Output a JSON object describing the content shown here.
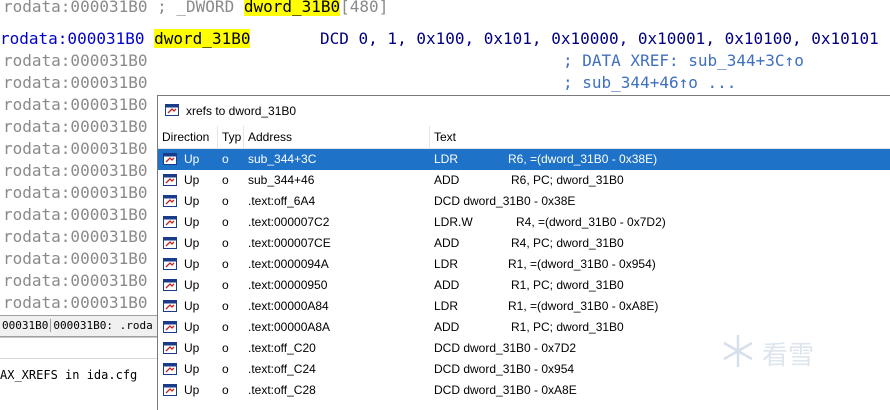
{
  "code_lines": [
    {
      "addr": "rodata:000031B0",
      "rest1": " ; _DWORD ",
      "hl": "dword_31B0",
      "rest2": "[480]"
    },
    {
      "addr": "rodata:000031B0",
      "label": "dword_31B0",
      "instr": "DCD 0, 1, 0x100, 0x101, 0x10000, 0x10001, 0x10100, 0x10101"
    },
    {
      "addr": "rodata:000031B0",
      "comment": "; DATA XREF: sub_344+3C↑o"
    },
    {
      "addr": "rodata:000031B0",
      "comment": "; sub_344+46↑o ..."
    },
    {
      "addr": "rodata:000031B0"
    },
    {
      "addr": "rodata:000031B0"
    },
    {
      "addr": "rodata:000031B0"
    },
    {
      "addr": "rodata:000031B0"
    },
    {
      "addr": "rodata:000031B0"
    },
    {
      "addr": "rodata:000031B0"
    },
    {
      "addr": "rodata:000031B0"
    },
    {
      "addr": "rodata:000031B0"
    },
    {
      "addr": "rodata:000031B0"
    },
    {
      "addr": "rodata:000031B0"
    }
  ],
  "status": {
    "left": "00031B0",
    "right": "000031B0: .roda"
  },
  "output": {
    "line": "AX_XREFS in ida.cfg"
  },
  "xrefs": {
    "title": "xrefs to dword_31B0",
    "columns": {
      "direction": "Direction",
      "type": "Typ",
      "address": "Address",
      "text": "Text"
    },
    "rows": [
      {
        "dir": "Up",
        "type": "o",
        "address": "sub_344+3C",
        "mnem": "LDR",
        "ops": "R6, =(dword_31B0 - 0x38E)",
        "selected": true
      },
      {
        "dir": "Up",
        "type": "o",
        "address": "sub_344+46",
        "mnem": "ADD",
        "ops": "R6, PC; dword_31B0"
      },
      {
        "dir": "Up",
        "type": "o",
        "address": ".text:off_6A4",
        "mnem": "DCD dword_31B0 - 0x38E",
        "ops": ""
      },
      {
        "dir": "Up",
        "type": "o",
        "address": ".text:000007C2",
        "mnem": "LDR.W",
        "ops": "R4, =(dword_31B0 - 0x7D2)"
      },
      {
        "dir": "Up",
        "type": "o",
        "address": ".text:000007CE",
        "mnem": "ADD",
        "ops": "R4, PC; dword_31B0"
      },
      {
        "dir": "Up",
        "type": "o",
        "address": ".text:0000094A",
        "mnem": "LDR",
        "ops": "R1, =(dword_31B0 - 0x954)"
      },
      {
        "dir": "Up",
        "type": "o",
        "address": ".text:00000950",
        "mnem": "ADD",
        "ops": "R1, PC; dword_31B0"
      },
      {
        "dir": "Up",
        "type": "o",
        "address": ".text:00000A84",
        "mnem": "LDR",
        "ops": "R1, =(dword_31B0 - 0xA8E)"
      },
      {
        "dir": "Up",
        "type": "o",
        "address": ".text:00000A8A",
        "mnem": "ADD",
        "ops": "R1, PC; dword_31B0"
      },
      {
        "dir": "Up",
        "type": "o",
        "address": ".text:off_C20",
        "mnem": "DCD dword_31B0 - 0x7D2",
        "ops": ""
      },
      {
        "dir": "Up",
        "type": "o",
        "address": ".text:off_C24",
        "mnem": "DCD dword_31B0 - 0x954",
        "ops": ""
      },
      {
        "dir": "Up",
        "type": "o",
        "address": ".text:off_C28",
        "mnem": "DCD dword_31B0 - 0xA8E",
        "ops": ""
      }
    ]
  },
  "watermark": {
    "text": "看雪"
  }
}
